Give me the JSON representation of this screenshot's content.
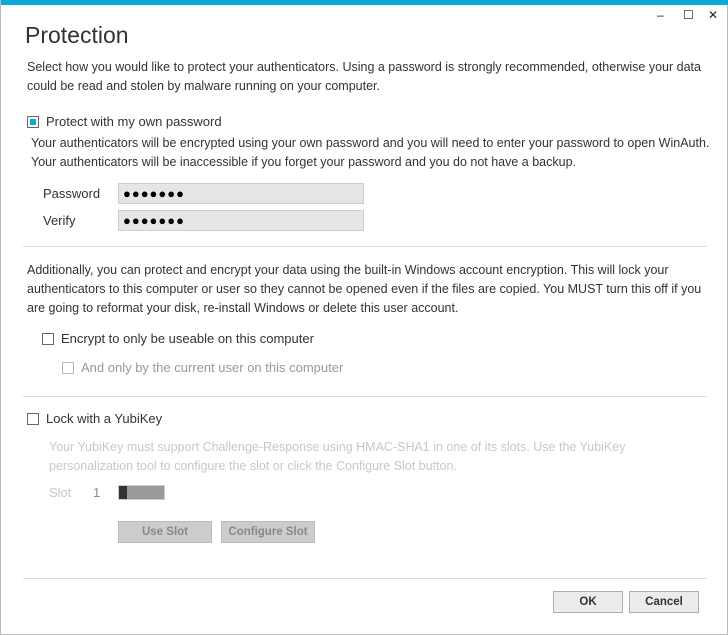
{
  "window": {
    "minimize": "–",
    "maximize": "☐",
    "close": "✕",
    "accent": "#0aa9d9"
  },
  "title": "Protection",
  "intro": "Select how you would like to protect your authenticators. Using a password is strongly recommended, otherwise your data could be read and stolen by malware running on your computer.",
  "password_section": {
    "checkbox_label": "Protect with my own password",
    "checked": true,
    "description": "Your authenticators will be encrypted using your own password and you will need to enter your password to open WinAuth. Your authenticators will be inaccessible if you forget your password and you do not have a backup.",
    "password_label": "Password",
    "password_value": "●●●●●●●",
    "verify_label": "Verify",
    "verify_value": "●●●●●●●"
  },
  "windows_section": {
    "description": "Additionally, you can protect and encrypt your data using the built-in Windows account encryption. This will lock your authenticators to this computer or user so they cannot be opened even if the files are copied. You MUST turn this off if you are going to reformat your disk, re-install Windows or delete this user account.",
    "machine_label": "Encrypt to only be useable on this computer",
    "user_label": "And only by the current user on this computer"
  },
  "yubikey_section": {
    "checkbox_label": "Lock with a YubiKey",
    "description": "Your YubiKey must support Challenge-Response using HMAC-SHA1 in one of its slots. Use the YubiKey personalization tool to configure the slot or click the Configure Slot button.",
    "slot_label": "Slot",
    "slot_value": "1",
    "use_slot": "Use Slot",
    "configure_slot": "Configure Slot"
  },
  "footer": {
    "ok": "OK",
    "cancel": "Cancel"
  }
}
